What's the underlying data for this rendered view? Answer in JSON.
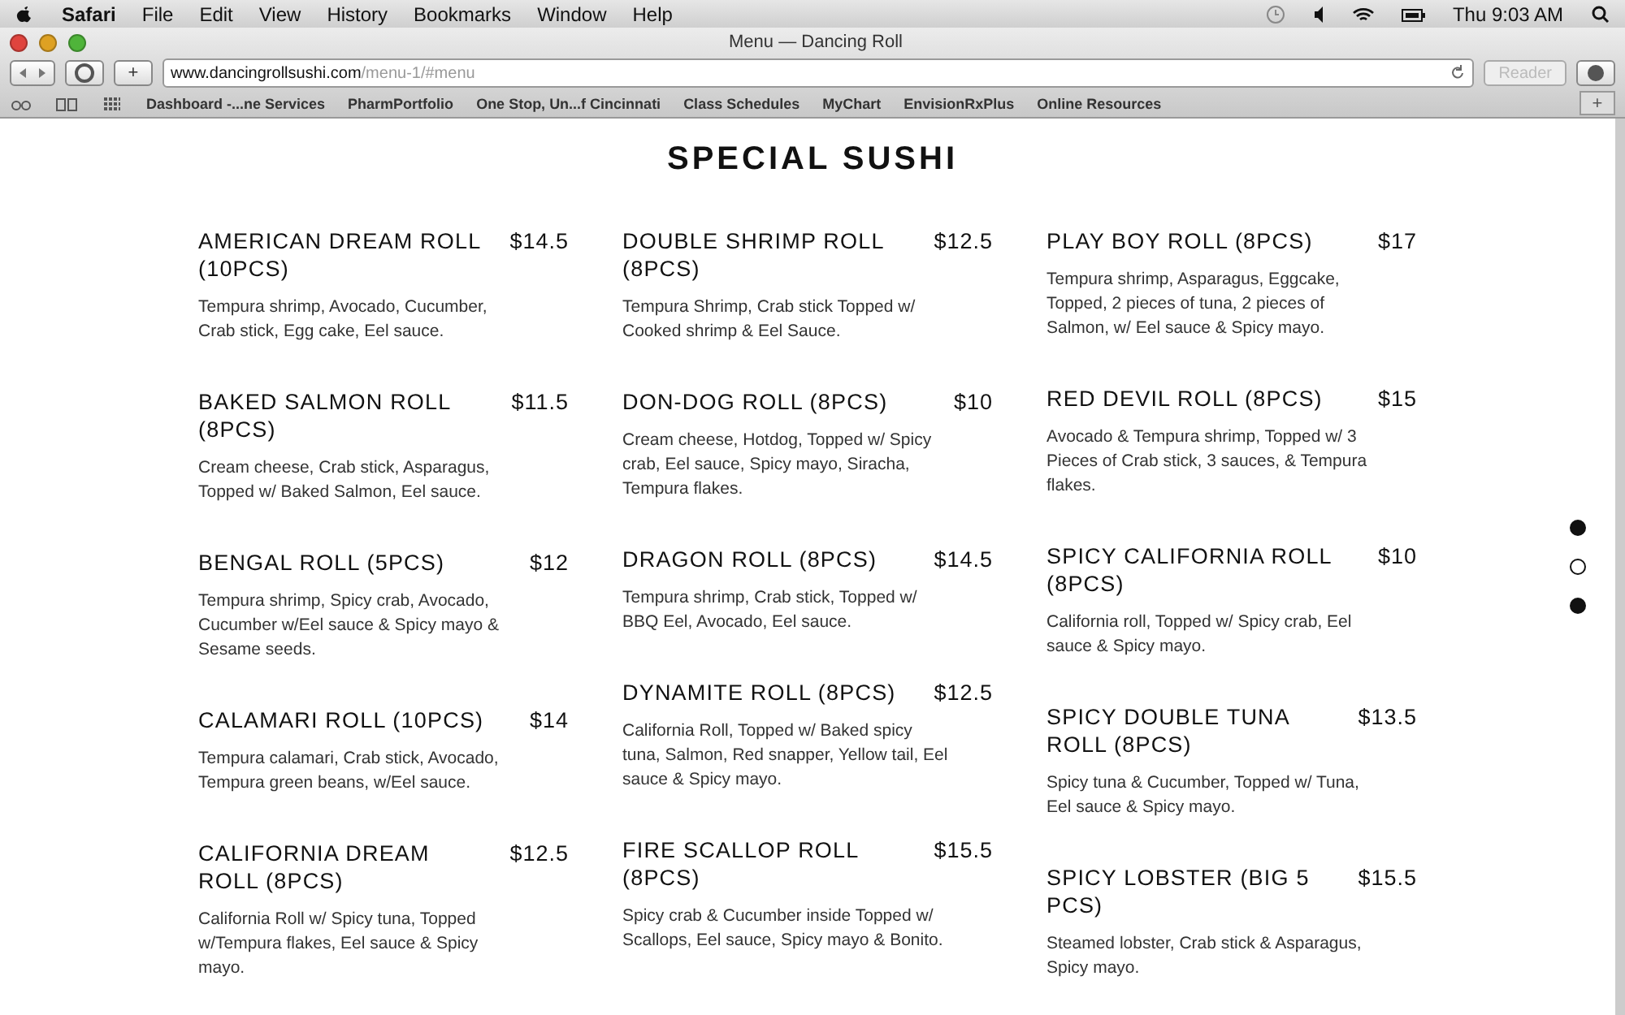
{
  "menu_bar": {
    "app": "Safari",
    "items": [
      "File",
      "Edit",
      "View",
      "History",
      "Bookmarks",
      "Window",
      "Help"
    ],
    "clock": "Thu 9:03 AM"
  },
  "window": {
    "title": "Menu — Dancing Roll"
  },
  "toolbar": {
    "new_tab": "+",
    "url_host": "www.dancingrollsushi.com",
    "url_path": "/menu-1/#menu",
    "reader": "Reader"
  },
  "bookmarks": [
    "Dashboard -...ne Services",
    "PharmPortfolio",
    "One Stop, Un...f Cincinnati",
    "Class Schedules",
    "MyChart",
    "EnvisionRxPlus",
    "Online Resources"
  ],
  "tab_add": "+",
  "heading": "SPECIAL SUSHI",
  "columns": [
    [
      {
        "name": "AMERICAN DREAM ROLL (10PCS)",
        "price": "$14.5",
        "description": "Tempura shrimp, Avocado, Cucumber, Crab stick, Egg cake, Eel sauce."
      },
      {
        "name": "BAKED SALMON ROLL (8PCS)",
        "price": "$11.5",
        "description": "Cream cheese, Crab stick, Asparagus, Topped w/ Baked Salmon, Eel sauce."
      },
      {
        "name": "BENGAL ROLL (5PCS)",
        "price": "$12",
        "description": "Tempura shrimp, Spicy crab, Avocado, Cucumber w/Eel sauce & Spicy mayo & Sesame seeds."
      },
      {
        "name": "CALAMARI ROLL (10PCS)",
        "price": "$14",
        "description": "Tempura calamari, Crab stick, Avocado, Tempura green beans, w/Eel sauce."
      },
      {
        "name": "CALIFORNIA DREAM ROLL (8PCS)",
        "price": "$12.5",
        "description": "California Roll w/ Spicy tuna, Topped w/Tempura flakes, Eel sauce & Spicy mayo."
      }
    ],
    [
      {
        "name": "DOUBLE SHRIMP ROLL (8PCS)",
        "price": "$12.5",
        "description": "Tempura Shrimp, Crab stick Topped w/ Cooked shrimp & Eel Sauce."
      },
      {
        "name": "DON-DOG ROLL (8PCS)",
        "price": "$10",
        "description": "Cream cheese, Hotdog, Topped w/ Spicy crab, Eel sauce, Spicy mayo, Siracha, Tempura flakes."
      },
      {
        "name": "DRAGON ROLL (8PCS)",
        "price": "$14.5",
        "description": "Tempura shrimp, Crab stick, Topped w/ BBQ Eel, Avocado, Eel sauce."
      },
      {
        "name": "DYNAMITE ROLL (8PCS)",
        "price": "$12.5",
        "description": "California Roll, Topped w/ Baked spicy tuna, Salmon, Red snapper, Yellow tail, Eel sauce & Spicy mayo."
      },
      {
        "name": "FIRE SCALLOP ROLL (8PCS)",
        "price": "$15.5",
        "description": "Spicy crab & Cucumber inside Topped w/ Scallops, Eel sauce, Spicy mayo & Bonito."
      }
    ],
    [
      {
        "name": "PLAY BOY ROLL (8PCS)",
        "price": "$17",
        "description": "Tempura shrimp, Asparagus, Eggcake, Topped, 2 pieces of tuna, 2 pieces of Salmon, w/ Eel sauce & Spicy mayo."
      },
      {
        "name": "RED DEVIL ROLL (8PCS)",
        "price": "$15",
        "description": "Avocado & Tempura shrimp, Topped w/ 3 Pieces of Crab stick, 3 sauces, & Tempura flakes."
      },
      {
        "name": "SPICY CALIFORNIA ROLL (8PCS)",
        "price": "$10",
        "description": "California roll, Topped w/ Spicy crab, Eel sauce & Spicy mayo."
      },
      {
        "name": "SPICY DOUBLE TUNA ROLL (8PCS)",
        "price": "$13.5",
        "description": "Spicy tuna & Cucumber, Topped w/ Tuna, Eel sauce & Spicy mayo."
      },
      {
        "name": "SPICY LOBSTER (BIG 5 PCS)",
        "price": "$15.5",
        "description": "Steamed lobster, Crab stick & Asparagus, Spicy mayo."
      }
    ]
  ],
  "section_dots": [
    {
      "selected": true
    },
    {
      "selected": false
    },
    {
      "selected": true
    }
  ]
}
